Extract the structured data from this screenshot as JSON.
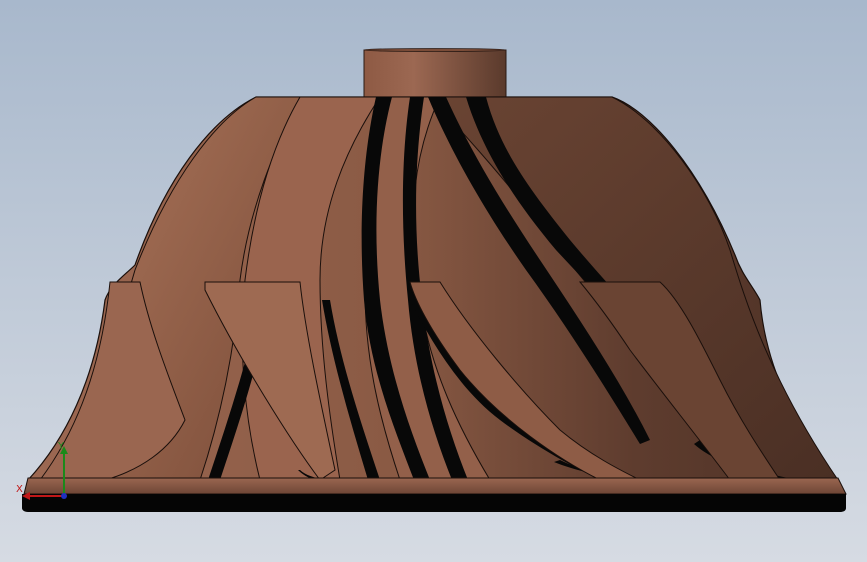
{
  "viewport": {
    "background_top": "#a8b8cc",
    "background_bottom": "#d6dbe3"
  },
  "model": {
    "part": "impeller",
    "material_color": "#8a5a44",
    "shadow_color": "#4e3226",
    "highlight_color": "#b07a60",
    "slot_color": "#080808"
  },
  "triad": {
    "x_label": "X",
    "y_label": "Y",
    "x_color": "#c01818",
    "y_color": "#1a8a1a",
    "z_color": "#2030c0"
  }
}
